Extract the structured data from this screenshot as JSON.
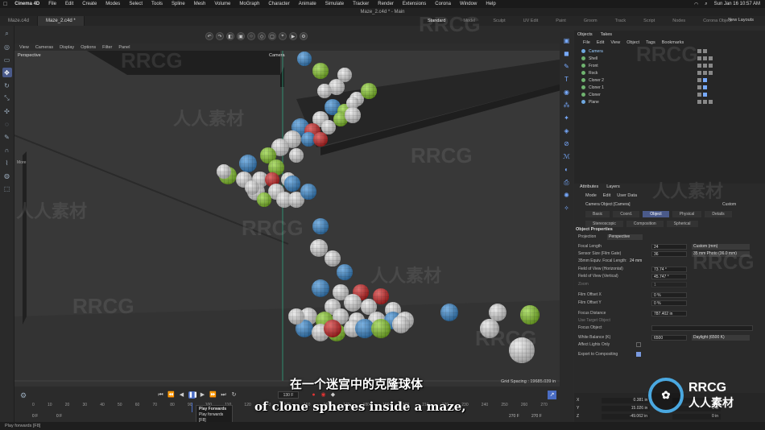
{
  "menubar": {
    "apple": "",
    "app": "Cinema 4D",
    "items": [
      "File",
      "Edit",
      "Create",
      "Modes",
      "Select",
      "Tools",
      "Spline",
      "Mesh",
      "Volume",
      "MoGraph",
      "Character",
      "Animate",
      "Simulate",
      "Tracker",
      "Render",
      "Extensions",
      "Corona",
      "Window",
      "Help"
    ],
    "clock": "Sun Jan 16  10:57 AM"
  },
  "window": {
    "title": "Maze_2.c4d * - Main"
  },
  "doc_tabs": [
    "Maze.c4d",
    "Maze_2.c4d *"
  ],
  "layouts": [
    "Standard",
    "Model",
    "Sculpt",
    "UV Edit",
    "Paint",
    "Groom",
    "Track",
    "Script",
    "Nodes",
    "Corona Object"
  ],
  "new_layouts": "New Layouts",
  "viewport": {
    "menu": [
      "View",
      "Cameras",
      "Display",
      "Options",
      "Filter",
      "Panel"
    ],
    "label": "Perspective",
    "camera_label": "Camera",
    "more_label": "More",
    "grid_spacing": "Grid Spacing : 19685.039 in",
    "bg_color": "#3d3d3d"
  },
  "timeline": {
    "ticks": [
      "0",
      "10",
      "20",
      "30",
      "40",
      "50",
      "60",
      "70",
      "80",
      "90",
      "100",
      "110",
      "120",
      "130",
      "140",
      "150",
      "160",
      "170",
      "180",
      "190",
      "200",
      "210",
      "220",
      "230",
      "240",
      "250",
      "260",
      "270"
    ],
    "current_frame": "130 F",
    "start_frame": "0 F",
    "start_frame2": "0 F",
    "end_frame": "270 F",
    "end_frame2": "270 F",
    "tooltip_title": "Play Forwards",
    "tooltip_sub": "Play forwards",
    "tooltip_key": "[F8]"
  },
  "status": "Play forwards [F8]",
  "objects": {
    "tabs": [
      "Objects",
      "Takes"
    ],
    "menu": [
      "File",
      "Edit",
      "View",
      "Object",
      "Tags",
      "Bookmarks"
    ],
    "rows": [
      "Camera",
      "Shell",
      "Front",
      "Rock",
      "Cloner 2",
      "Cloner 1",
      "Cloner",
      "Plane"
    ]
  },
  "attributes": {
    "tabs": [
      "Attributes",
      "Layers"
    ],
    "menu": [
      "Mode",
      "Edit",
      "User Data"
    ],
    "object": "Camera Object [Camera]",
    "preset": "Custom",
    "subtabs": [
      "Basic",
      "Coord.",
      "Object",
      "Physical",
      "Details",
      "Stereoscopic",
      "Composition",
      "Spherical"
    ],
    "active_subtab": "Object",
    "section": "Object Properties",
    "props": [
      {
        "label": "Projection",
        "value": "Perspective"
      },
      {
        "label": "Focal Length",
        "value": "24",
        "extra": "Custom (mm)"
      },
      {
        "label": "Sensor Size (Film Gate)",
        "value": "36",
        "extra": "35 mm Photo (36.0 mm)"
      },
      {
        "label": "35mm Equiv. Focal Length:",
        "value": "24 mm"
      },
      {
        "label": "Field of View (Horizontal)",
        "value": "73.74 °"
      },
      {
        "label": "Field of View (Vertical)",
        "value": "45.747 °"
      },
      {
        "label": "Zoom",
        "value": "1"
      },
      {
        "label": "Film Offset X",
        "value": "0 %"
      },
      {
        "label": "Film Offset Y",
        "value": "0 %"
      },
      {
        "label": "Focus Distance",
        "value": "787.402 in"
      },
      {
        "label": "Use Target Object",
        "value": ""
      },
      {
        "label": "Focus Object",
        "value": ""
      },
      {
        "label": "White Balance (K)",
        "value": "6500",
        "extra": "Daylight (6500 K)"
      },
      {
        "label": "Affect Lights Only",
        "value": ""
      },
      {
        "label": "Export to Compositing",
        "value": ""
      }
    ]
  },
  "coords": [
    {
      "axis": "X",
      "pos": "0.381 in",
      "rot": "0°"
    },
    {
      "axis": "Y",
      "pos": "15.026 in",
      "rot": "0 in"
    },
    {
      "axis": "Z",
      "pos": "-49.062 in",
      "rot": "0 in"
    }
  ],
  "subtitles": {
    "zh": "在一个迷宫中的克隆球体",
    "en": "of clone spheres inside a maze,"
  },
  "watermark": {
    "text": "RRCG",
    "cn": "人人素材",
    "logo_line1": "RRCG",
    "logo_line2": "人人素材"
  },
  "sphere_colors": {
    "green": "#8bd12a",
    "blue": "#3a8ed8",
    "red": "#d42222",
    "white": "#e8e8e8"
  }
}
